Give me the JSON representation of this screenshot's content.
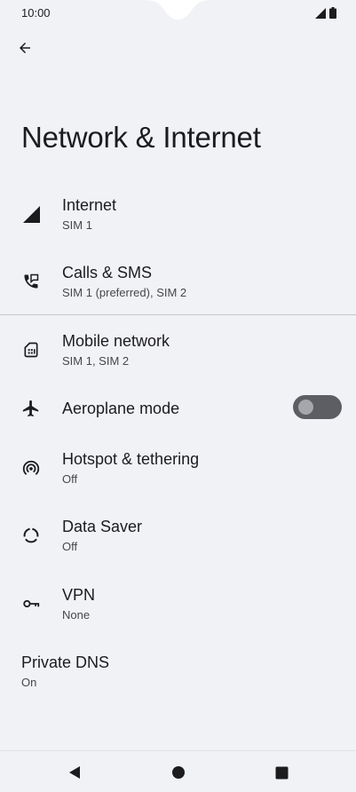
{
  "status_bar": {
    "time": "10:00"
  },
  "page": {
    "title": "Network & Internet"
  },
  "items": [
    {
      "title": "Internet",
      "subtitle": "SIM 1",
      "icon": "signal-icon"
    },
    {
      "title": "Calls & SMS",
      "subtitle": "SIM 1 (preferred), SIM 2",
      "icon": "calls-sms-icon"
    },
    {
      "title": "Mobile network",
      "subtitle": "SIM 1, SIM 2",
      "icon": "sim-card-icon"
    },
    {
      "title": "Aeroplane mode",
      "subtitle": "",
      "icon": "airplane-icon",
      "toggle": "off"
    },
    {
      "title": "Hotspot & tethering",
      "subtitle": "Off",
      "icon": "hotspot-icon"
    },
    {
      "title": "Data Saver",
      "subtitle": "Off",
      "icon": "data-saver-icon"
    },
    {
      "title": "VPN",
      "subtitle": "None",
      "icon": "key-icon"
    },
    {
      "title": "Private DNS",
      "subtitle": "On",
      "icon": ""
    }
  ],
  "colors": {
    "background": "#f1f2f6",
    "text_primary": "#1c1c1f",
    "text_secondary": "#46464b",
    "toggle_track_off": "#5d5e63",
    "toggle_knob_off": "#a6a7ad"
  }
}
